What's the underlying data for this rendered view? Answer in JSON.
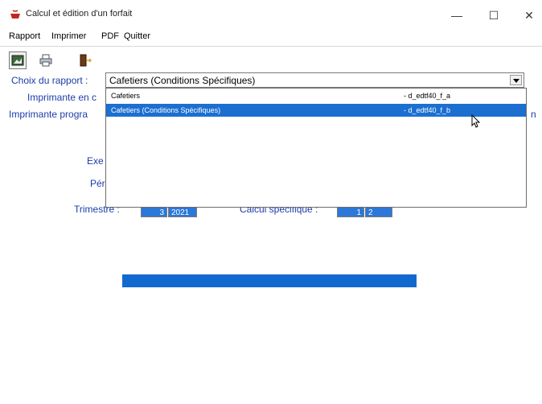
{
  "window": {
    "title": "Calcul et édition d'un forfait",
    "minimize_glyph": "—",
    "maximize_glyph": "☐",
    "close_glyph": "✕"
  },
  "menu": {
    "items": [
      {
        "label": "Rapport"
      },
      {
        "label": "Imprimer"
      },
      {
        "label": "PDF"
      },
      {
        "label": "Quitter"
      }
    ]
  },
  "toolbar": {
    "icons": [
      "image-report-icon",
      "printer-icon",
      "exit-door-icon"
    ]
  },
  "form": {
    "choix_label": "Choix du rapport :",
    "imprimante_label": "Imprimante en c",
    "imprimante_prog_label": "Imprimante progra",
    "right_fragment": "n",
    "exe_label": "Exe",
    "per_label": "Pér",
    "trimestre_label": "Trimestre :",
    "trimestre_value": "3",
    "annee_value": "2021",
    "calcul_label": "Calcul spécifique :",
    "calcul_option_1": "1",
    "calcul_option_2": "2"
  },
  "combo": {
    "selected": "Cafetiers (Conditions Spécifiques)",
    "options": [
      {
        "label": "Cafetiers",
        "code": "- d_edtf40_f_a",
        "selected": false
      },
      {
        "label": "Cafetiers (Conditions Spécifiques)",
        "code": "- d_edtf40_f_b",
        "selected": true
      }
    ]
  },
  "progress": {
    "fraction": 1.0
  }
}
